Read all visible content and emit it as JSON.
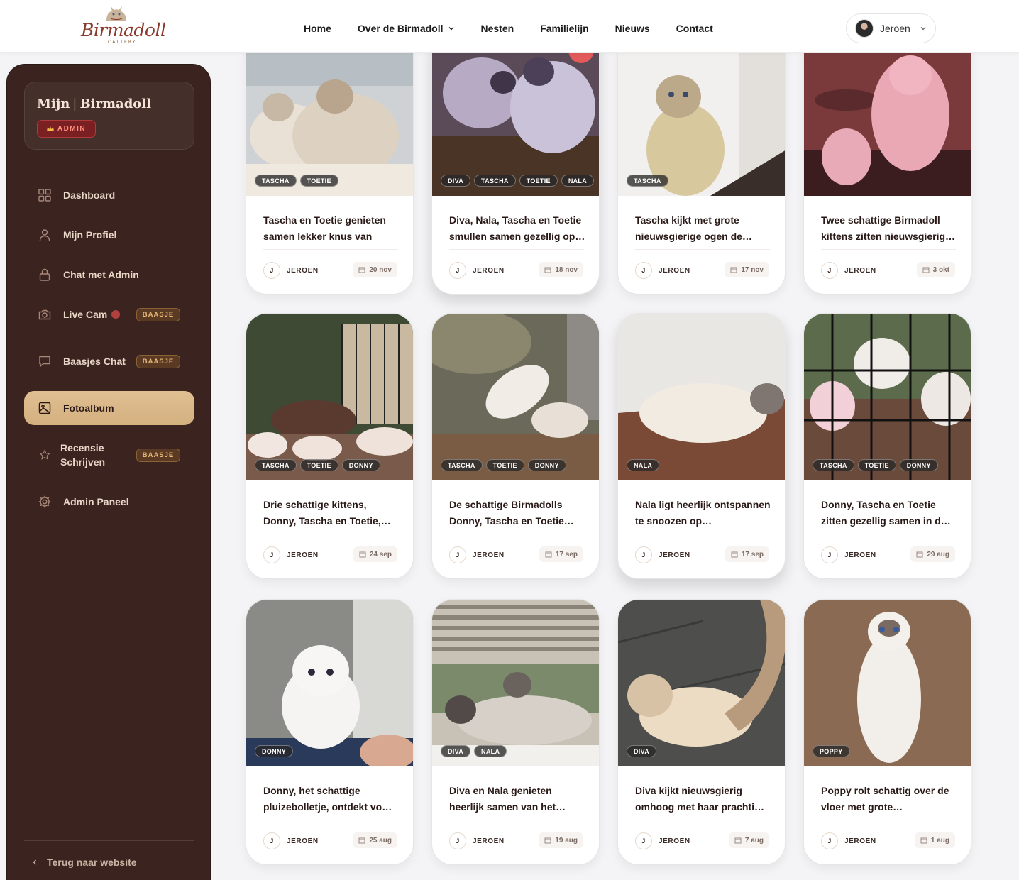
{
  "header": {
    "logo_text": "Birmadoll",
    "logo_sub": "CATTERY",
    "nav": [
      {
        "label": "Home"
      },
      {
        "label": "Over de Birmadoll",
        "has_dropdown": true
      },
      {
        "label": "Nesten"
      },
      {
        "label": "Familielijn"
      },
      {
        "label": "Nieuws"
      },
      {
        "label": "Contact"
      }
    ],
    "user": {
      "name": "Jeroen"
    }
  },
  "sidebar": {
    "brand_left": "Mijn",
    "brand_right": "Birmadoll",
    "role_badge": "ADMIN",
    "items": [
      {
        "label": "Dashboard",
        "icon": "grid-icon"
      },
      {
        "label": "Mijn Profiel",
        "icon": "user-icon"
      },
      {
        "label": "Chat met Admin",
        "icon": "lock-icon"
      },
      {
        "label": "Live Cam",
        "icon": "camera-icon",
        "badge": "BAASJE",
        "live": true
      },
      {
        "label": "Baasjes Chat",
        "icon": "chat-icon",
        "badge": "BAASJE"
      },
      {
        "label": "Fotoalbum",
        "icon": "image-icon",
        "active": true
      },
      {
        "label": "Recensie Schrijven",
        "icon": "star-icon",
        "badge": "BAASJE"
      },
      {
        "label": "Admin Paneel",
        "icon": "gear-icon"
      }
    ],
    "back_link": "Terug naar website"
  },
  "album": {
    "posts": [
      {
        "tags": [
          "TASCHA",
          "TOETIE"
        ],
        "title": "Tascha en Toetie genieten samen lekker knus van het…",
        "author": "JEROEN",
        "author_initial": "J",
        "date": "20 nov"
      },
      {
        "tags": [
          "DIVA",
          "TASCHA",
          "TOETIE",
          "NALA"
        ],
        "title": "Diva, Nala, Tascha en Toetie smullen samen gezellig op…",
        "author": "JEROEN",
        "author_initial": "J",
        "date": "18 nov"
      },
      {
        "tags": [
          "TASCHA"
        ],
        "title": "Tascha kijkt met grote nieuwsgierige ogen de…",
        "author": "JEROEN",
        "author_initial": "J",
        "date": "17 nov"
      },
      {
        "tags": [],
        "title": "Twee schattige Birmadoll kittens zitten nieuwsgierig…",
        "author": "JEROEN",
        "author_initial": "J",
        "date": "3 okt"
      },
      {
        "tags": [
          "TASCHA",
          "TOETIE",
          "DONNY"
        ],
        "title": "Drie schattige kittens, Donny, Tascha en Toetie,…",
        "author": "JEROEN",
        "author_initial": "J",
        "date": "24 sep"
      },
      {
        "tags": [
          "TASCHA",
          "TOETIE",
          "DONNY"
        ],
        "title": "De schattige Birmadolls Donny, Tascha en Toetie…",
        "author": "JEROEN",
        "author_initial": "J",
        "date": "17 sep"
      },
      {
        "tags": [
          "NALA"
        ],
        "title": "Nala ligt heerlijk ontspannen te snoozen op…",
        "author": "JEROEN",
        "author_initial": "J",
        "date": "17 sep"
      },
      {
        "tags": [
          "TASCHA",
          "TOETIE",
          "DONNY"
        ],
        "title": "Donny, Tascha en Toetie zitten gezellig samen in d…",
        "author": "JEROEN",
        "author_initial": "J",
        "date": "29 aug"
      },
      {
        "tags": [
          "DONNY"
        ],
        "title": "Donny, het schattige pluizebolletje, ontdekt vo…",
        "author": "JEROEN",
        "author_initial": "J",
        "date": "25 aug"
      },
      {
        "tags": [
          "DIVA",
          "NALA"
        ],
        "title": "Diva en Nala genieten heerlijk samen van het…",
        "author": "JEROEN",
        "author_initial": "J",
        "date": "19 aug"
      },
      {
        "tags": [
          "DIVA"
        ],
        "title": "Diva kijkt nieuwsgierig omhoog met haar prachti…",
        "author": "JEROEN",
        "author_initial": "J",
        "date": "7 aug"
      },
      {
        "tags": [
          "POPPY"
        ],
        "title": "Poppy rolt schattig over de vloer met grote…",
        "author": "JEROEN",
        "author_initial": "J",
        "date": "1 aug"
      }
    ]
  },
  "colors": {
    "sidebar_bg": "#3b2420",
    "active_item": "#d9b887",
    "admin_badge": "#7a1f22",
    "baasje_badge": "#5a3a22",
    "live_dot": "#b0413e"
  }
}
